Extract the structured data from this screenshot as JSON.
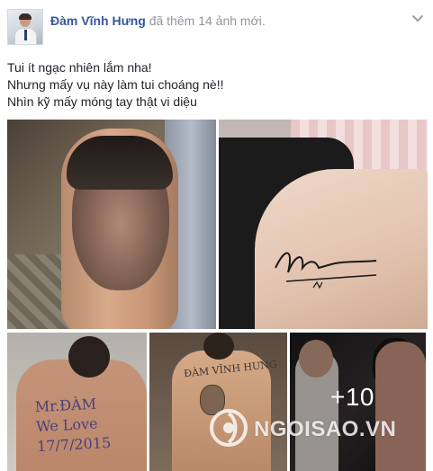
{
  "post": {
    "author": "Đàm Vĩnh Hưng",
    "action_prefix": "đã thêm",
    "action_count": "14",
    "action_suffix": "ảnh mới.",
    "message_lines": [
      "Tui ít ngạc nhiên lắm nha!",
      "Nhưng mấy vụ này làm tui choáng nè!!",
      "Nhìn kỹ mấy móng tay thật vi diệu"
    ]
  },
  "photos": {
    "p3_writing": [
      "Mr.ĐÀM",
      "We Love",
      "17/7/2015"
    ],
    "p4_writing": "ĐÀM VĨNH HƯNG",
    "more_count": "+10"
  },
  "watermark": {
    "text": "NGOISAO.VN"
  },
  "icons": {
    "options": "chevron-down-icon"
  },
  "colors": {
    "author": "#365899",
    "meta": "#90949c",
    "text": "#1d2129"
  }
}
